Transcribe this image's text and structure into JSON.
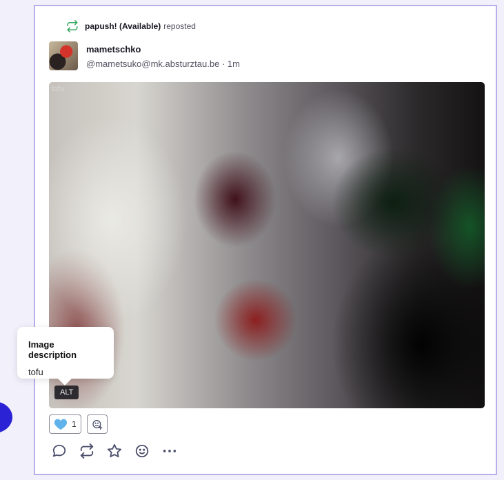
{
  "repost": {
    "user": "papush! (Available)",
    "label": "reposted",
    "icon": "repost-icon"
  },
  "author": {
    "display_name": "mametschko",
    "handle": "@mametsuko@mk.absturztau.be",
    "separator": "·",
    "time": "1m"
  },
  "media": {
    "label": "tofu",
    "alt_badge": "ALT"
  },
  "tooltip": {
    "title": "Image description",
    "body": "tofu"
  },
  "reactions": [
    {
      "emoji": "blue-heart",
      "count": "1"
    }
  ],
  "actions": [
    "reply-icon",
    "repost-icon",
    "favorite-icon",
    "react-icon",
    "more-icon"
  ],
  "colors": {
    "accent": "#2b22d6",
    "repost_green": "#2fa55b",
    "card_border": "#b5b0ea",
    "icon": "#4b4f6b"
  }
}
